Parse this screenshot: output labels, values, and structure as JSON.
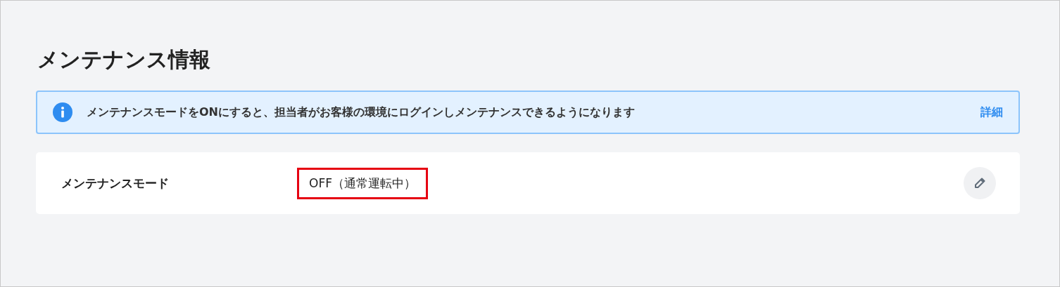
{
  "title": "メンテナンス情報",
  "notice": {
    "text": "メンテナンスモードをONにすると、担当者がお客様の環境にログインしメンテナンスできるようになります",
    "link": "詳細"
  },
  "settings": [
    {
      "label": "メンテナンスモード",
      "value": "OFF（通常運転中）",
      "highlighted": true
    }
  ]
}
